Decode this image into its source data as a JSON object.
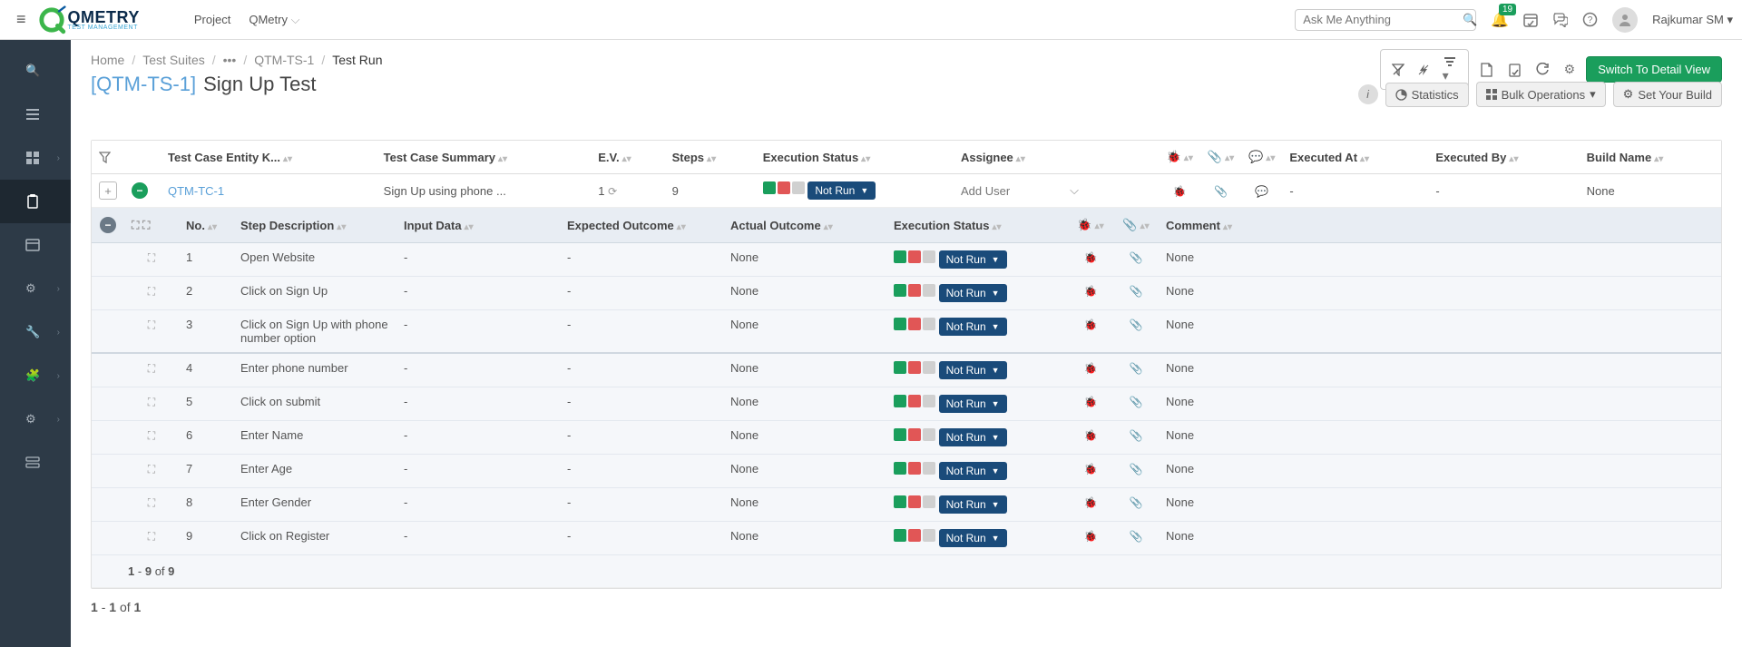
{
  "header": {
    "project_label": "Project",
    "project_name": "QMetry",
    "search_placeholder": "Ask Me Anything",
    "notification_count": "19",
    "user_name": "Rajkumar SM"
  },
  "breadcrumb": {
    "home": "Home",
    "suites": "Test Suites",
    "tsid": "QTM-TS-1",
    "current": "Test Run"
  },
  "title": {
    "id": "[QTM-TS-1]",
    "name": "Sign Up Test"
  },
  "actions": {
    "switch_view": "Switch To Detail View",
    "statistics": "Statistics",
    "bulk_ops": "Bulk Operations",
    "set_build": "Set Your Build"
  },
  "columns": {
    "tc_key": "Test Case Entity K...",
    "tc_summary": "Test Case Summary",
    "ev": "E.V.",
    "steps": "Steps",
    "exec_status": "Execution Status",
    "assignee": "Assignee",
    "executed_at": "Executed At",
    "executed_by": "Executed By",
    "build": "Build Name"
  },
  "testcase": {
    "key": "QTM-TC-1",
    "summary": "Sign Up using phone ...",
    "ev": "1",
    "steps": "9",
    "status": "Not Run",
    "assignee_placeholder": "Add User",
    "executed_at": "-",
    "executed_by": "-",
    "build": "None"
  },
  "step_columns": {
    "no": "No.",
    "desc": "Step Description",
    "input": "Input Data",
    "expected": "Expected Outcome",
    "actual": "Actual Outcome",
    "status": "Execution Status",
    "comment": "Comment"
  },
  "steps": [
    {
      "no": "1",
      "desc": "Open Website",
      "input": "-",
      "expected": "-",
      "actual": "None",
      "status": "Not Run",
      "comment": "None"
    },
    {
      "no": "2",
      "desc": "Click on Sign Up",
      "input": "-",
      "expected": "-",
      "actual": "None",
      "status": "Not Run",
      "comment": "None"
    },
    {
      "no": "3",
      "desc": "Click on Sign Up with phone number option",
      "input": "-",
      "expected": "-",
      "actual": "None",
      "status": "Not Run",
      "comment": "None"
    },
    {
      "no": "4",
      "desc": "Enter phone number",
      "input": "-",
      "expected": "-",
      "actual": "None",
      "status": "Not Run",
      "comment": "None",
      "sep": true
    },
    {
      "no": "5",
      "desc": "Click on submit",
      "input": "-",
      "expected": "-",
      "actual": "None",
      "status": "Not Run",
      "comment": "None"
    },
    {
      "no": "6",
      "desc": "Enter Name",
      "input": "-",
      "expected": "-",
      "actual": "None",
      "status": "Not Run",
      "comment": "None"
    },
    {
      "no": "7",
      "desc": "Enter Age",
      "input": "-",
      "expected": "-",
      "actual": "None",
      "status": "Not Run",
      "comment": "None"
    },
    {
      "no": "8",
      "desc": "Enter Gender",
      "input": "-",
      "expected": "-",
      "actual": "None",
      "status": "Not Run",
      "comment": "None"
    },
    {
      "no": "9",
      "desc": "Click on Register",
      "input": "-",
      "expected": "-",
      "actual": "None",
      "status": "Not Run",
      "comment": "None"
    }
  ],
  "steps_pagination": {
    "from": "1",
    "to": "9",
    "total": "9",
    "of": "of",
    "dash": "-"
  },
  "tc_pagination": {
    "from": "1",
    "to": "1",
    "total": "1",
    "of": "of",
    "dash": "-"
  }
}
